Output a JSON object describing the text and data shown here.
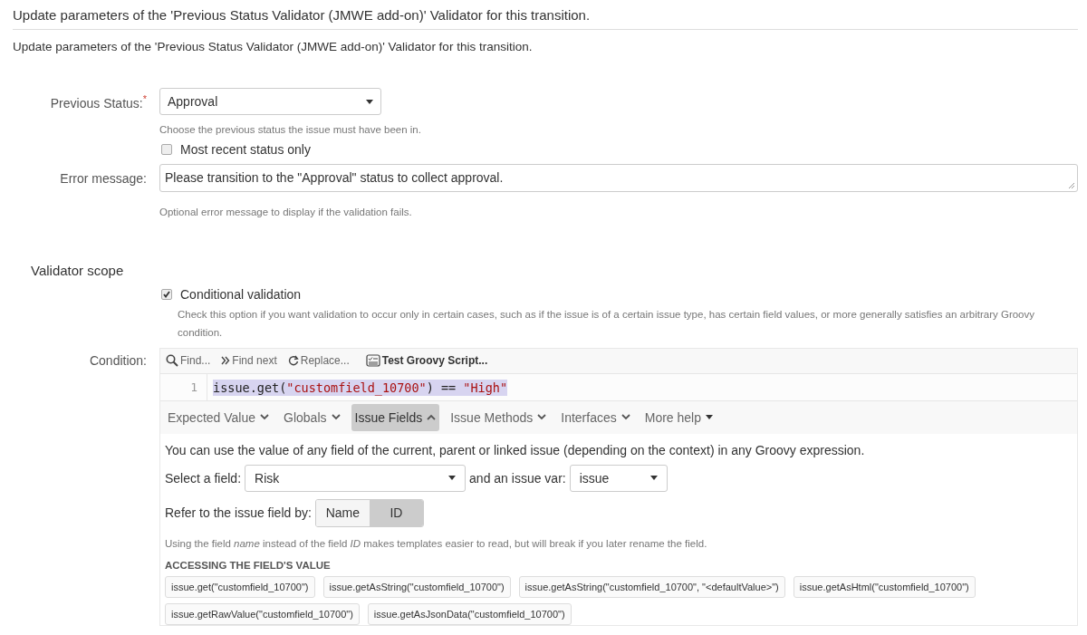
{
  "header": {
    "title": "Update parameters of the 'Previous Status Validator (JMWE add-on)' Validator for this transition."
  },
  "description": "Update parameters of the 'Previous Status Validator (JMWE add-on)' Validator for this transition.",
  "previous_status": {
    "label": "Previous Status:",
    "required_mark": "*",
    "value": "Approval",
    "help": "Choose the previous status the issue must have been in."
  },
  "most_recent": {
    "label": "Most recent status only",
    "checked": false
  },
  "error_message": {
    "label": "Error message:",
    "value": "Please transition to the \"Approval\" status to collect approval.",
    "help": "Optional error message to display if the validation fails."
  },
  "scope": {
    "title": "Validator scope",
    "conditional": {
      "label": "Conditional validation",
      "checked": true,
      "help": "Check this option if you want validation to occur only in certain cases, such as if the issue is of a certain issue type, has certain field values, or more generally satisfies an arbitrary Groovy condition."
    }
  },
  "condition": {
    "label": "Condition:",
    "toolbar": [
      {
        "label": "Find...",
        "kind": "search"
      },
      {
        "label": "Find next",
        "kind": "next"
      },
      {
        "label": "Replace...",
        "kind": "replace"
      },
      {
        "label": "Test Groovy Script...",
        "kind": "test"
      }
    ],
    "lines": [
      {
        "number": "1",
        "selected": true,
        "tokens": [
          {
            "text": "issue.get(",
            "kind": "plain"
          },
          {
            "text": "\"customfield_10700\"",
            "kind": "string"
          },
          {
            "text": ") == ",
            "kind": "plain"
          },
          {
            "text": "\"High\"",
            "kind": "string"
          }
        ]
      }
    ],
    "help_tabs": [
      {
        "label": "Expected Value",
        "selected": false,
        "kind": "chevron"
      },
      {
        "label": "Globals",
        "selected": false,
        "kind": "chevron"
      },
      {
        "label": "Issue Fields",
        "selected": true,
        "kind": "chevron"
      },
      {
        "label": "Issue Methods",
        "selected": false,
        "kind": "chevron"
      },
      {
        "label": "Interfaces",
        "selected": false,
        "kind": "chevron"
      },
      {
        "label": "More help",
        "selected": false,
        "kind": "caret"
      }
    ],
    "intro": "You can use the value of any field of the current, parent or linked issue (depending on the context) in any Groovy expression.",
    "select_field": {
      "label": "Select a field:",
      "value": "Risk"
    },
    "issue_var": {
      "label": "and an issue var:",
      "value": "issue"
    },
    "refer_by": {
      "label": "Refer to the issue field by:",
      "options": [
        {
          "label": "Name",
          "selected": false
        },
        {
          "label": "ID",
          "selected": true
        }
      ]
    },
    "note": "Using the field *name* instead of the field *ID* makes templates easier to read, but will break if you later rename the field.",
    "section_title": "ACCESSING THE FIELD'S VALUE",
    "snippets": [
      "issue.get(\"customfield_10700\")",
      "issue.getAsString(\"customfield_10700\")",
      "issue.getAsString(\"customfield_10700\", \"<defaultValue>\")",
      "issue.getAsHtml(\"customfield_10700\")",
      "issue.getRawValue(\"customfield_10700\")",
      "issue.getAsJsonData(\"customfield_10700\")"
    ]
  }
}
